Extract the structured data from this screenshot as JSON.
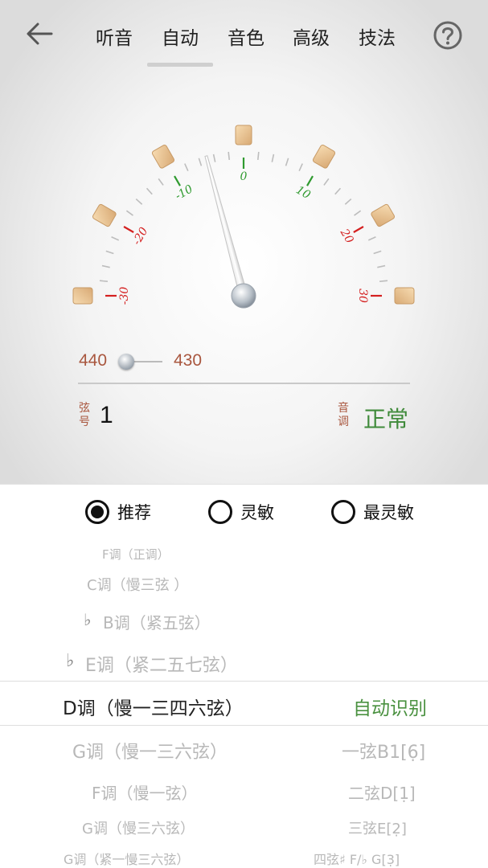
{
  "nav": {
    "tabs": [
      {
        "label": "听音"
      },
      {
        "label": "自动"
      },
      {
        "label": "音色"
      },
      {
        "label": "高级"
      },
      {
        "label": "技法"
      }
    ],
    "active_tab": "自动"
  },
  "dial": {
    "scale_labels": [
      "-30",
      "-20",
      "-10",
      "0",
      "10",
      "20",
      "30"
    ],
    "needle_value": -5
  },
  "reference": {
    "left_value": "440",
    "right_value": "430"
  },
  "string_info": {
    "label": "弦号",
    "label_char_1": "弦",
    "label_char_2": "号",
    "value": "1"
  },
  "tune_info": {
    "label_char_1": "音",
    "label_char_2": "调",
    "status": "正常"
  },
  "modes": [
    {
      "label": "推荐",
      "selected": true
    },
    {
      "label": "灵敏",
      "selected": false
    },
    {
      "label": "最灵敏",
      "selected": false
    }
  ],
  "keys": {
    "k1": "F调（正调）",
    "k2": "C调（慢三弦 ）",
    "k3_flat": "♭",
    "k3": "B调（紧五弦）",
    "k4_flat": "♭",
    "k4": "E调（紧二五七弦）",
    "selected": "D调（慢一三四六弦）",
    "k6": "G调（慢一三六弦）",
    "k7": "F调（慢一弦）",
    "k8": "G调（慢三六弦）",
    "k9": "G调（紧一慢三六弦）"
  },
  "auto_detect": "自动识别",
  "string_notes": {
    "s1": "一弦B1[6̣]",
    "s2": "二弦D[1̣]",
    "s3": "三弦E[2̣]",
    "s4": "四弦♯ F/♭ G[3̣]"
  },
  "colors": {
    "red_scale": "#d42020",
    "green_scale": "#2f9a2f",
    "status_green": "#3f8a3a",
    "label_brown": "#a9573f"
  }
}
